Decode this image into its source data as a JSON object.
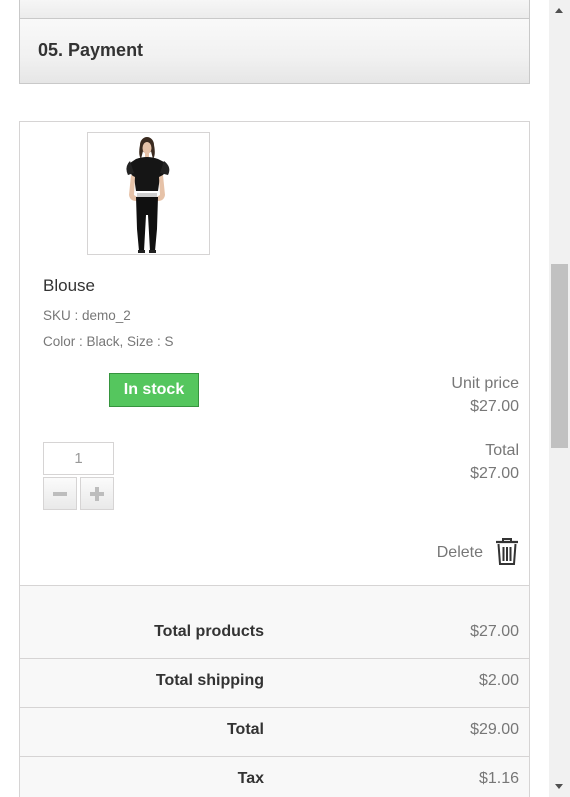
{
  "checkout": {
    "step_title": "05. Payment"
  },
  "product": {
    "image_icon": "product-photo-woman-black-blouse",
    "name": "Blouse",
    "sku": "SKU : demo_2",
    "attributes": "Color : Black, Size : S",
    "stock_label": "In stock",
    "unit_price_label": "Unit price",
    "unit_price": "$27.00",
    "total_label": "Total",
    "total": "$27.00",
    "quantity": "1",
    "decrease_icon": "minus-icon",
    "increase_icon": "plus-icon",
    "delete_label": "Delete",
    "delete_icon": "trash-icon"
  },
  "totals": [
    {
      "label": "Total products",
      "value": "$27.00"
    },
    {
      "label": "Total shipping",
      "value": "$2.00"
    },
    {
      "label": "Total",
      "value": "$29.00"
    },
    {
      "label": "Tax",
      "value": "$1.16"
    }
  ],
  "colors": {
    "stock_badge": "#55c65e",
    "stock_badge_border": "#36943e",
    "muted_text": "#777777",
    "border": "#d6d4d4"
  }
}
